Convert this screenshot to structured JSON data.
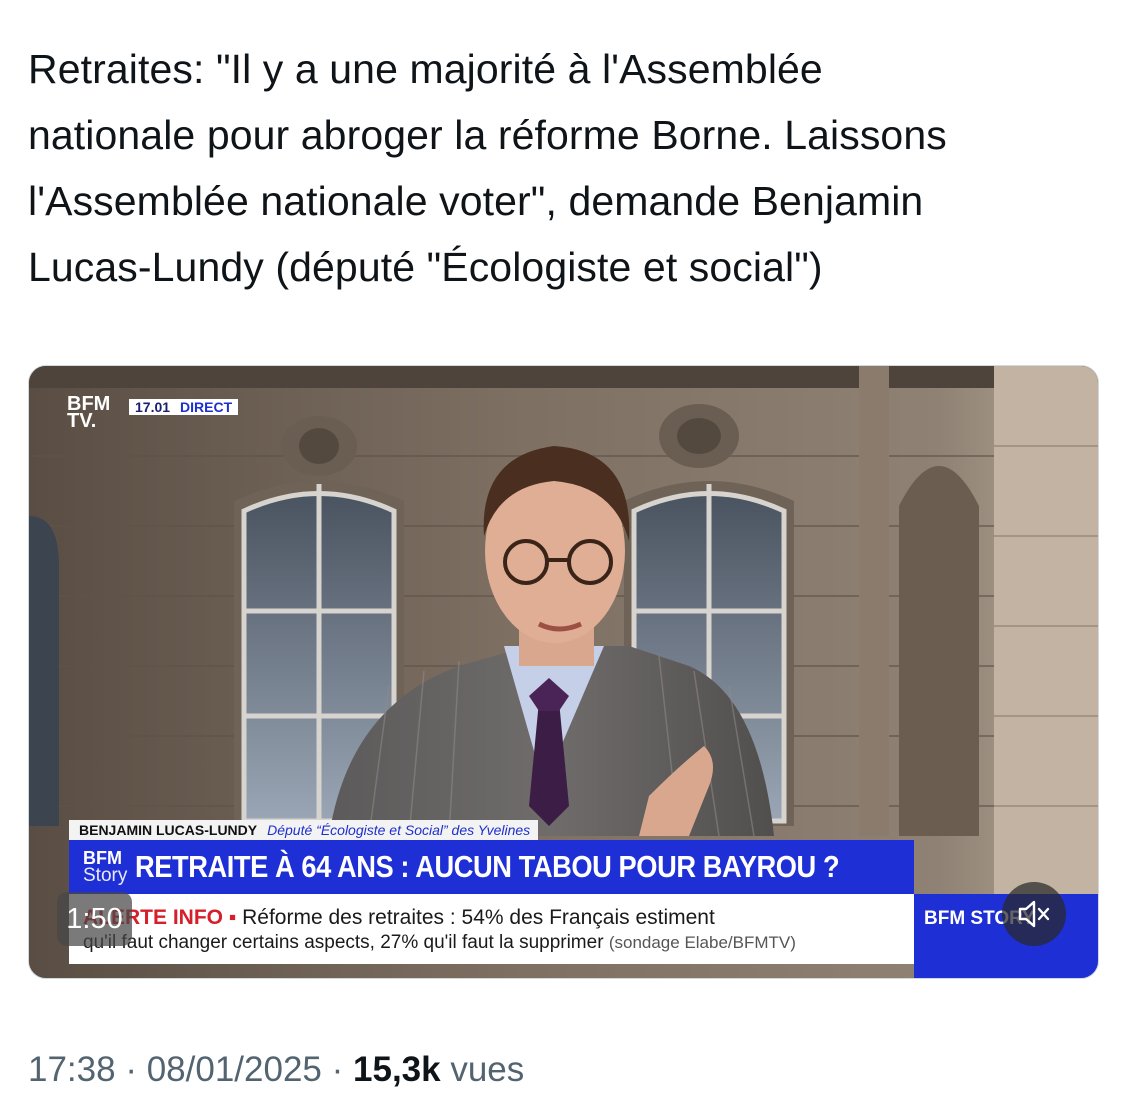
{
  "tweet": {
    "text_lines": [
      "Retraites: \"Il y a une majorité à l'Assemblée",
      "nationale pour abroger la réforme Borne. Laissons",
      "l'Assemblée nationale voter\", demande Benjamin",
      "Lucas-Lundy (député \"Écologiste et social\")"
    ],
    "time": "17:38",
    "date": "08/01/2025",
    "separator": "·",
    "views_count": "15,3k",
    "views_label": "vues"
  },
  "video": {
    "channel_logo_line1": "BFM",
    "channel_logo_line2": "TV.",
    "live_time": "17.01",
    "live_label": "DIRECT",
    "speaker_name": "BENJAMIN LUCAS-LUNDY",
    "speaker_role": "Député “Écologiste et Social” des Yvelines",
    "story_logo_line1": "BFM",
    "story_logo_line2": "Story",
    "headline": "RETRAITE À 64 ANS : AUCUN TABOU POUR BAYROU ?",
    "alert_label": "ALERTE INFO ▪",
    "ticker_line1": "Réforme des retraites : 54% des Français estiment",
    "ticker_line2": "qu'il faut changer certains aspects, 27% qu'il faut la supprimer",
    "ticker_source": "(sondage Elabe/BFMTV)",
    "story_box": "BFM STORY",
    "timer": "1:50",
    "mute_icon": "speaker-muted-icon"
  },
  "colors": {
    "bfm_blue": "#1e2fd6",
    "alert_red": "#d61f2a",
    "meta_gray": "#536471"
  }
}
